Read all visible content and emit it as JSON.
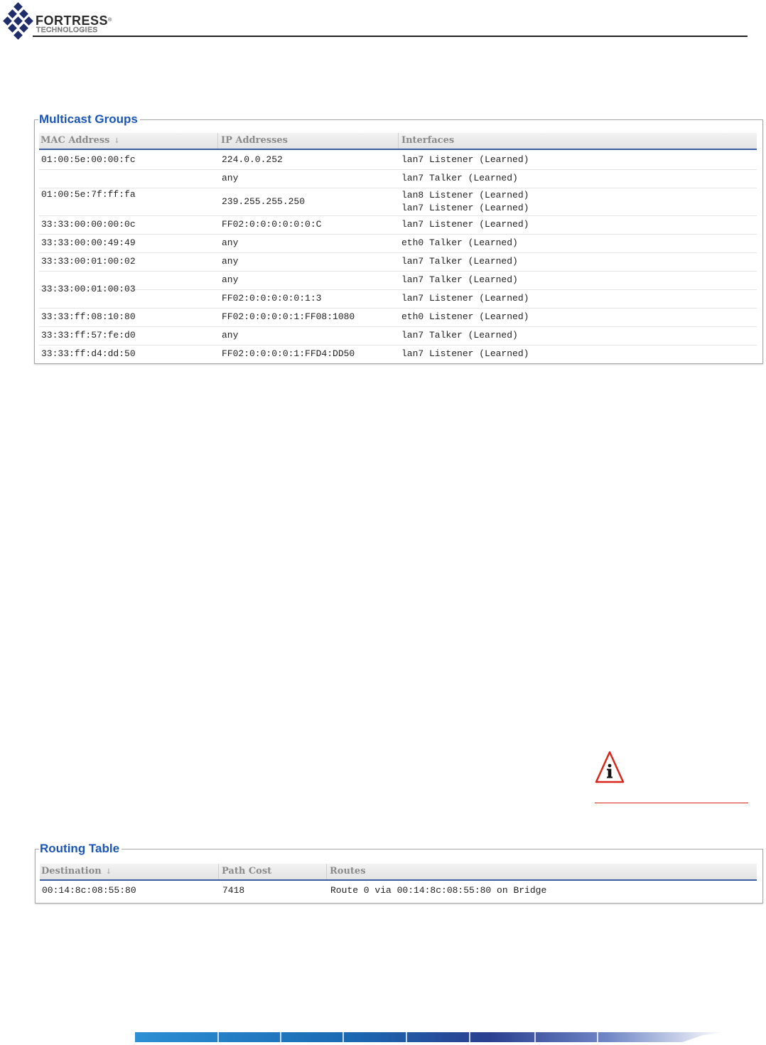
{
  "header": {
    "brand_name": "FORTRESS",
    "brand_reg": "®",
    "brand_sub": "TECHNOLOGIES",
    "logo_icon": "diamond-grid-logo",
    "brand_color": "#1f2d6b"
  },
  "multicast": {
    "legend": "Multicast Groups",
    "columns": [
      "MAC Address",
      "IP Addresses",
      "Interfaces"
    ],
    "sort_icon": "↓",
    "rows": [
      {
        "mac": "01:00:5e:00:00:fc",
        "ip": "224.0.0.252",
        "iface": "lan7 Listener (Learned)"
      },
      {
        "mac": "",
        "ip": "any",
        "iface": "lan7 Talker (Learned)"
      },
      {
        "mac": "01:00:5e:7f:ff:fa",
        "ip": "239.255.255.250",
        "iface": "lan8 Listener (Learned)\nlan7 Listener (Learned)"
      },
      {
        "mac": "33:33:00:00:00:0c",
        "ip": "FF02:0:0:0:0:0:0:C",
        "iface": "lan7 Listener (Learned)"
      },
      {
        "mac": "33:33:00:00:49:49",
        "ip": "any",
        "iface": "eth0 Talker (Learned)"
      },
      {
        "mac": "33:33:00:01:00:02",
        "ip": "any",
        "iface": "lan7 Talker (Learned)"
      },
      {
        "mac": "",
        "ip": "any",
        "iface": "lan7 Talker (Learned)"
      },
      {
        "mac": "33:33:00:01:00:03",
        "ip": "FF02:0:0:0:0:0:1:3",
        "iface": "lan7 Listener (Learned)"
      },
      {
        "mac": "33:33:ff:08:10:80",
        "ip": "FF02:0:0:0:0:1:FF08:1080",
        "iface": "eth0 Listener (Learned)"
      },
      {
        "mac": "33:33:ff:57:fe:d0",
        "ip": "any",
        "iface": "lan7 Talker (Learned)"
      },
      {
        "mac": "33:33:ff:d4:dd:50",
        "ip": "FF02:0:0:0:0:1:FFD4:DD50",
        "iface": "lan7 Listener (Learned)"
      }
    ]
  },
  "routing": {
    "legend": "Routing Table",
    "columns": [
      "Destination",
      "Path Cost",
      "Routes"
    ],
    "sort_icon": "↓",
    "rows": [
      {
        "dest": "00:14:8c:08:55:80",
        "cost": "7418",
        "routes": "Route 0 via 00:14:8c:08:55:80 on Bridge"
      }
    ]
  },
  "note": {
    "icon": "warning-info-icon",
    "accent_color": "#d8261c"
  }
}
